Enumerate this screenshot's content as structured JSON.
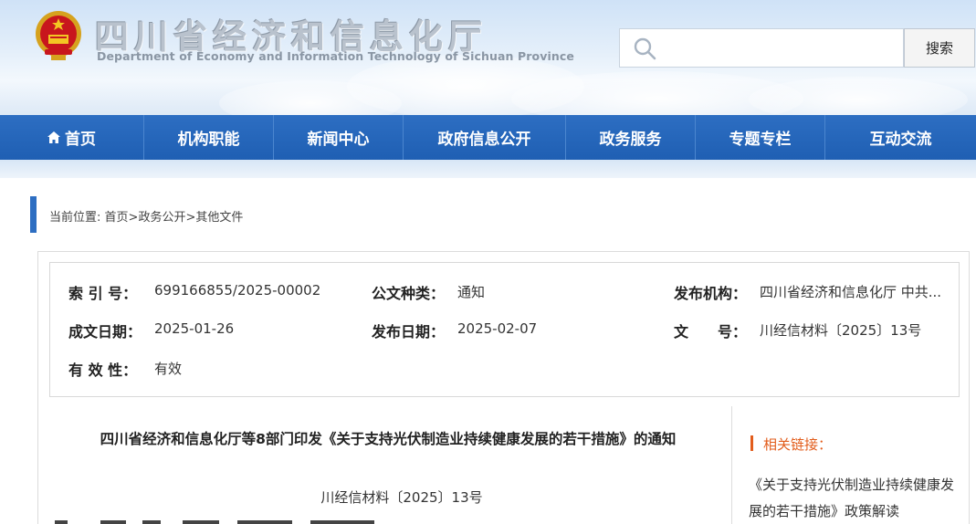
{
  "header": {
    "site_title": "四川省经济和信息化厅",
    "site_subtitle": "Department of Economy and Information Technology of Sichuan Province",
    "search": {
      "placeholder": "",
      "button_label": "搜索"
    },
    "emblem_icon": "national-emblem-icon"
  },
  "nav": {
    "items": [
      {
        "label": "首页",
        "icon": "home-icon"
      },
      {
        "label": "机构职能"
      },
      {
        "label": "新闻中心"
      },
      {
        "label": "政府信息公开"
      },
      {
        "label": "政务服务"
      },
      {
        "label": "专题专栏"
      },
      {
        "label": "互动交流"
      }
    ]
  },
  "breadcrumb": {
    "prefix": "当前位置:",
    "items": [
      "首页",
      "政务公开",
      "其他文件"
    ],
    "separator": ">"
  },
  "meta": {
    "index_label": "索 引 号：",
    "index_value": "699166855/2025-00002",
    "doc_type_label": "公文种类：",
    "doc_type_value": "通知",
    "publisher_label": "发布机构：",
    "publisher_value": "四川省经济和信息化厅 中共...",
    "created_label": "成文日期：",
    "created_value": "2025-01-26",
    "published_label": "发布日期：",
    "published_value": "2025-02-07",
    "docno_label": "文　　号：",
    "docno_value": "川经信材料〔2025〕13号",
    "validity_label": "有 效 性：",
    "validity_value": "有效"
  },
  "document": {
    "title": "四川省经济和信息化厅等8部门印发《关于支持光伏制造业持续健康发展的若干措施》的通知",
    "number": "川经信材料〔2025〕13号"
  },
  "sidebar": {
    "heading": "相关链接：",
    "links": [
      "《关于支持光伏制造业持续健康发展的若干措施》政策解读"
    ]
  },
  "colors": {
    "nav_blue": "#1f5fb3",
    "accent_orange": "#e25d1c",
    "crumb_bar": "#2d6ec2"
  }
}
